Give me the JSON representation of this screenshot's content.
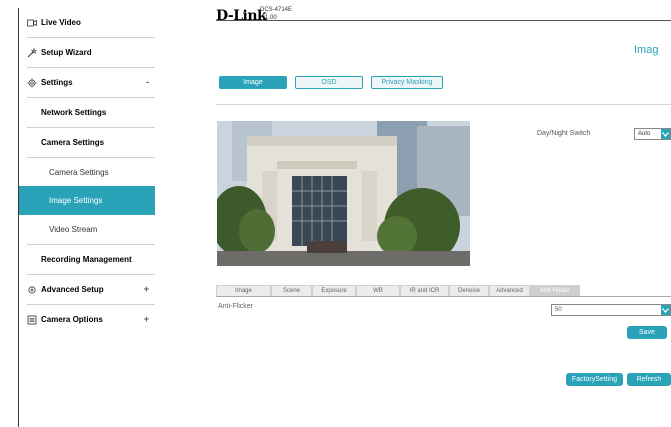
{
  "sidebar": {
    "live_video": "Live Video",
    "setup_wizard": "Setup Wizard",
    "settings": "Settings",
    "settings_toggle": "-",
    "network_settings": "Network Settings",
    "camera_settings": "Camera Settings",
    "camera_settings_sub": "Camera Settings",
    "image_settings": "Image Settings",
    "video_stream": "Video Stream",
    "recording_management": "Recording Management",
    "advanced_setup": "Advanced Setup",
    "advanced_toggle": "+",
    "camera_options": "Camera Options",
    "camera_options_toggle": "+"
  },
  "header": {
    "logo": "D-Link",
    "model": "DCS-4714E",
    "version": "v1.00",
    "page_title": "Imag"
  },
  "top_tabs": [
    "Image",
    "OSD",
    "Privacy Masking"
  ],
  "day_night": {
    "label": "Day/Night Switch",
    "value": "Auto"
  },
  "sub_tabs": [
    "Image",
    "Scene",
    "Exposure",
    "WB",
    "IR and ICR",
    "Denoise",
    "Advanced",
    "Anti-Flicker"
  ],
  "anti_flicker": {
    "label": "Anti-Flicker",
    "value": "50"
  },
  "buttons": {
    "save": "Save",
    "factory": "FactorySetting",
    "refresh": "Refresh"
  },
  "colors": {
    "accent": "#2aa2b8",
    "active_bg": "#2aa2b8"
  },
  "icons": {
    "live_video": "video-icon",
    "setup_wizard": "wand-icon",
    "settings": "gear-icon",
    "advanced_setup": "advanced-gear-icon",
    "camera_options": "list-icon",
    "dropdown": "chevron-down-icon"
  }
}
